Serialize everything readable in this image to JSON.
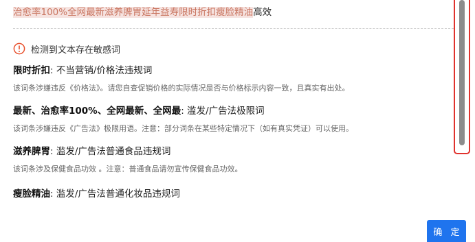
{
  "title_line": {
    "flagged_text": "治愈率100%全网最新滋养脾胃延年益寿限时折扣瘦脸精油",
    "normal_text": "高效"
  },
  "warning": {
    "icon": "exclamation-circle-icon",
    "icon_color": "#e8502c",
    "text": "检测到文本存在敏感词"
  },
  "items": [
    {
      "keywords": "限时折扣",
      "separator": ":",
      "category": "不当营销/价格法违规词",
      "description": "该词条涉嫌违反《价格法》。请您自查促销价格的实际情况是否与价格标示内容一致，且真实有出处。"
    },
    {
      "keywords": "最新、治愈率100%、全网最新、全网最",
      "separator": ":",
      "category": "滥发/广告法极限词",
      "description": "该词条涉嫌违反《广告法》极限用语。注意：部分词条在某些特定情况下（如有真实凭证）可以使用。"
    },
    {
      "keywords": "滋养脾胃",
      "separator": ":",
      "category": "滥发/广告法普通食品违规词",
      "description": "该词条涉及保健食品功效 。注意：普通食品请勿宣传保健食品功效。"
    },
    {
      "keywords": "瘦脸精油",
      "separator": ":",
      "category": "滥发/广告法普通化妆品违规词",
      "description": ""
    }
  ],
  "footer": {
    "confirm_label": "确 定"
  },
  "colors": {
    "flagged_text": "#c97560",
    "flagged_bg": "#f6e3e0",
    "primary_button": "#1f74ee",
    "highlight_box": "#e0322d",
    "scroll_thumb": "#8c8c8c"
  }
}
